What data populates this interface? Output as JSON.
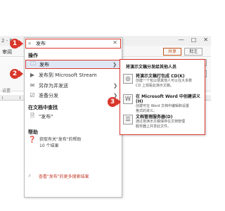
{
  "app": {
    "title": "2 - Po",
    "window_controls": [
      "—",
      "□",
      "✕"
    ]
  },
  "ribbon": {
    "tab_review": "审阅",
    "share_label": "共享",
    "comments_label": "批注",
    "group_label": "设置"
  },
  "search": {
    "value": "发布",
    "placeholder": "发布"
  },
  "sections": {
    "actions_title": "操作",
    "find_title": "在文档中查找",
    "help_title": "帮助"
  },
  "actions": [
    {
      "label": "发布",
      "icon": "folder-icon",
      "has_submenu": true
    },
    {
      "label": "发布到 Microsoft Stream",
      "icon": "stream-icon",
      "has_submenu": false
    },
    {
      "label": "另存为并发送",
      "icon": "save-send-icon",
      "has_submenu": true
    },
    {
      "label": "准备分发",
      "icon": "prepare-icon",
      "has_submenu": true
    }
  ],
  "find": {
    "label": "\"发布\""
  },
  "help": {
    "label_line1": "获取有关\"发布\"的帮助",
    "label_line2": "10 个结果"
  },
  "more_results": "查看\"发布\"的更多搜索结果",
  "submenu": {
    "header": "将演示文稿分发给其他人员",
    "items": [
      {
        "title": "将演示文稿打包成 CD(K)",
        "desc_line1": "创建一个包以便其他人可以在大多数",
        "desc_line2": "CD 上观看此演示文稿。",
        "icon": "cd-icon"
      },
      {
        "title": "在 Microsoft Word 中创建讲义(H)",
        "desc_line1": "创建可在 Word 文档中编辑和设置",
        "desc_line2": "格式的讲义。",
        "icon": "word-icon"
      },
      {
        "title": "文档管理服务器(D)",
        "desc_line1": "通过将演示文稿保存在文档管理",
        "desc_line2": "服务器上共享此文件。",
        "icon": "server-icon"
      }
    ]
  },
  "callouts": [
    "1",
    "2",
    "3"
  ],
  "colors": {
    "accent_red": "#d9362b",
    "highlight": "#dfe7f5",
    "share": "#c6551b"
  }
}
